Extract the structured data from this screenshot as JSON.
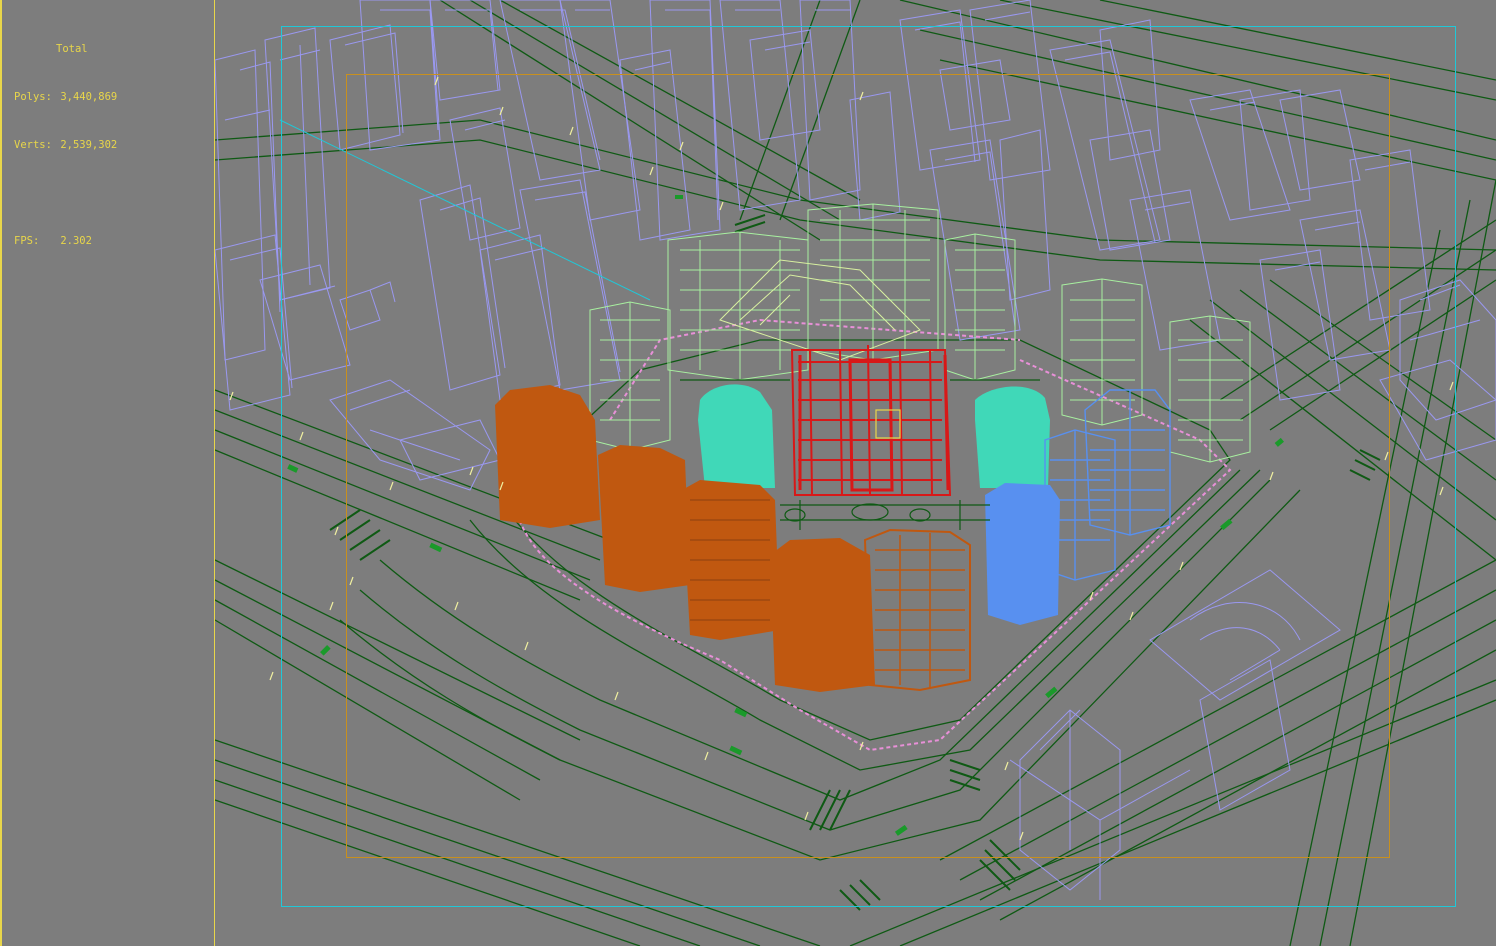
{
  "viewport": {
    "title": "Total",
    "stats": [
      {
        "label": "Polys:",
        "value": "3,440,869"
      },
      {
        "label": "Verts:",
        "value": "2,539,302"
      }
    ],
    "fps": {
      "label": "FPS:",
      "value": "2.302"
    }
  },
  "colors": {
    "background": "#7d7d7d",
    "stats_text": "#e8d64a",
    "roads": "#0f5a14",
    "context_buildings": "#9a98f0",
    "green_towers": "#a8f0a0",
    "teal_towers": "#40d8b8",
    "red_tower": "#d81818",
    "blue_towers": "#5890f0",
    "orange_towers": "#c05810",
    "boundary_path": "#e890d8",
    "safe_frame_outer": "#20c8d8",
    "safe_frame_inner": "#c8901e"
  }
}
